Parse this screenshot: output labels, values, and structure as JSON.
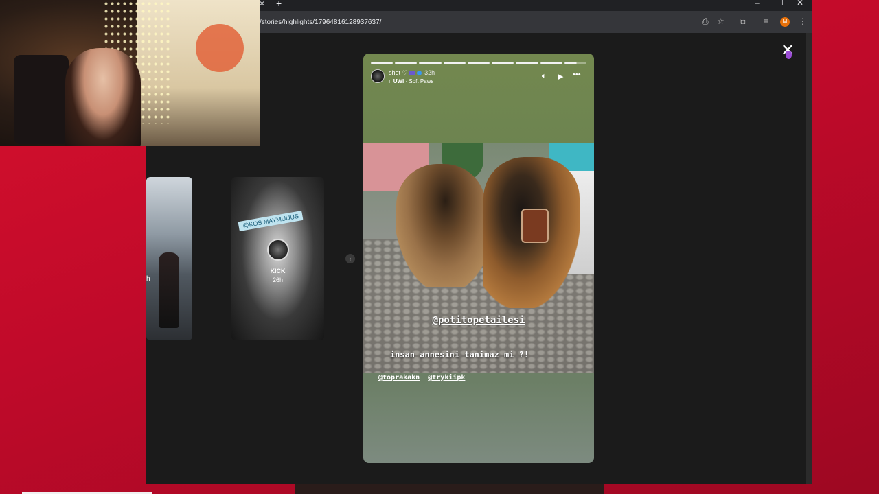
{
  "browser": {
    "tab_close": "×",
    "new_tab": "+",
    "window_controls": {
      "minimize": "–",
      "maximize": "☐",
      "close": "✕"
    },
    "url": "/stories/highlights/17964816128937637/",
    "profile_initial": "M"
  },
  "viewer": {
    "close_label": "✕",
    "previews": [
      {
        "name": "",
        "time": "h"
      },
      {
        "sticker": "@KOS MAYMUUUS",
        "name": "KICK",
        "time": "26h"
      }
    ],
    "prev_arrow": "‹"
  },
  "story": {
    "username": "shot",
    "heart": "♡",
    "time": "32h",
    "music_artist": "UWI",
    "music_track": "Soft Paws",
    "mention": "@potitopetailesi",
    "caption": "insan annesini tanimaz mi ?!",
    "tags": [
      "@toprakakn",
      "@trykiipk"
    ]
  }
}
